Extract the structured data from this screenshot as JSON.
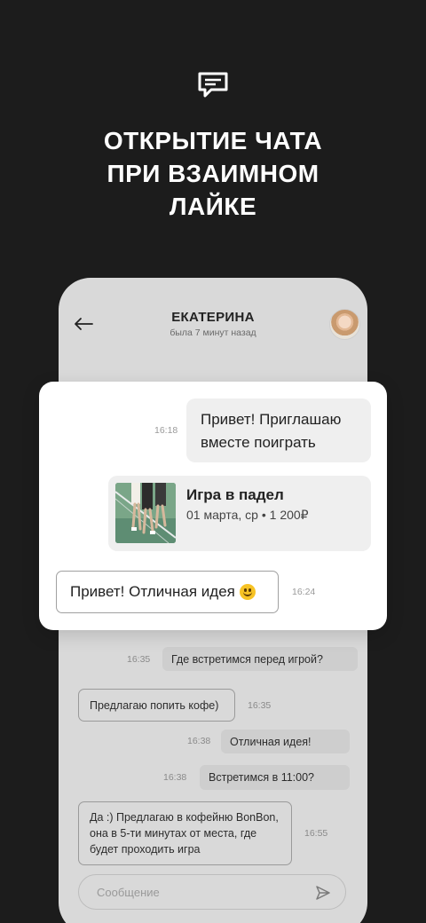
{
  "promo": {
    "icon": "chat-icon",
    "headline": "ОТКРЫТИЕ ЧАТА\nПРИ ВЗАИМНОМ\nЛАЙКЕ"
  },
  "chat_header": {
    "name": "ЕКАТЕРИНА",
    "status": "была 7 минут назад",
    "back_icon": "back-arrow-icon",
    "avatar": "avatar"
  },
  "highlight": {
    "incoming": {
      "text": "Привет! Приглашаю вместе поиграть",
      "time": "16:18"
    },
    "event": {
      "title": "Игра в падел",
      "subtitle": "01 марта, ср  •  1 200₽"
    },
    "outgoing": {
      "text": "Привет! Отличная идея",
      "time": "16:24"
    }
  },
  "messages": [
    {
      "text": "Где встретимся перед игрой?",
      "time": "16:35",
      "side": "in"
    },
    {
      "text": "Предлагаю попить кофе)",
      "time": "16:35",
      "side": "out"
    },
    {
      "text": "Отличная идея!",
      "time": "16:38",
      "side": "in"
    },
    {
      "text": "Встретимся в 11:00?",
      "time": "16:38",
      "side": "in"
    },
    {
      "text": "Да :) Предлагаю в кофейню BonBon, она в 5-ти минутах от места, где будет проходить игра",
      "time": "16:55",
      "side": "out"
    }
  ],
  "composer": {
    "placeholder": "Сообщение",
    "send_icon": "send-icon"
  }
}
